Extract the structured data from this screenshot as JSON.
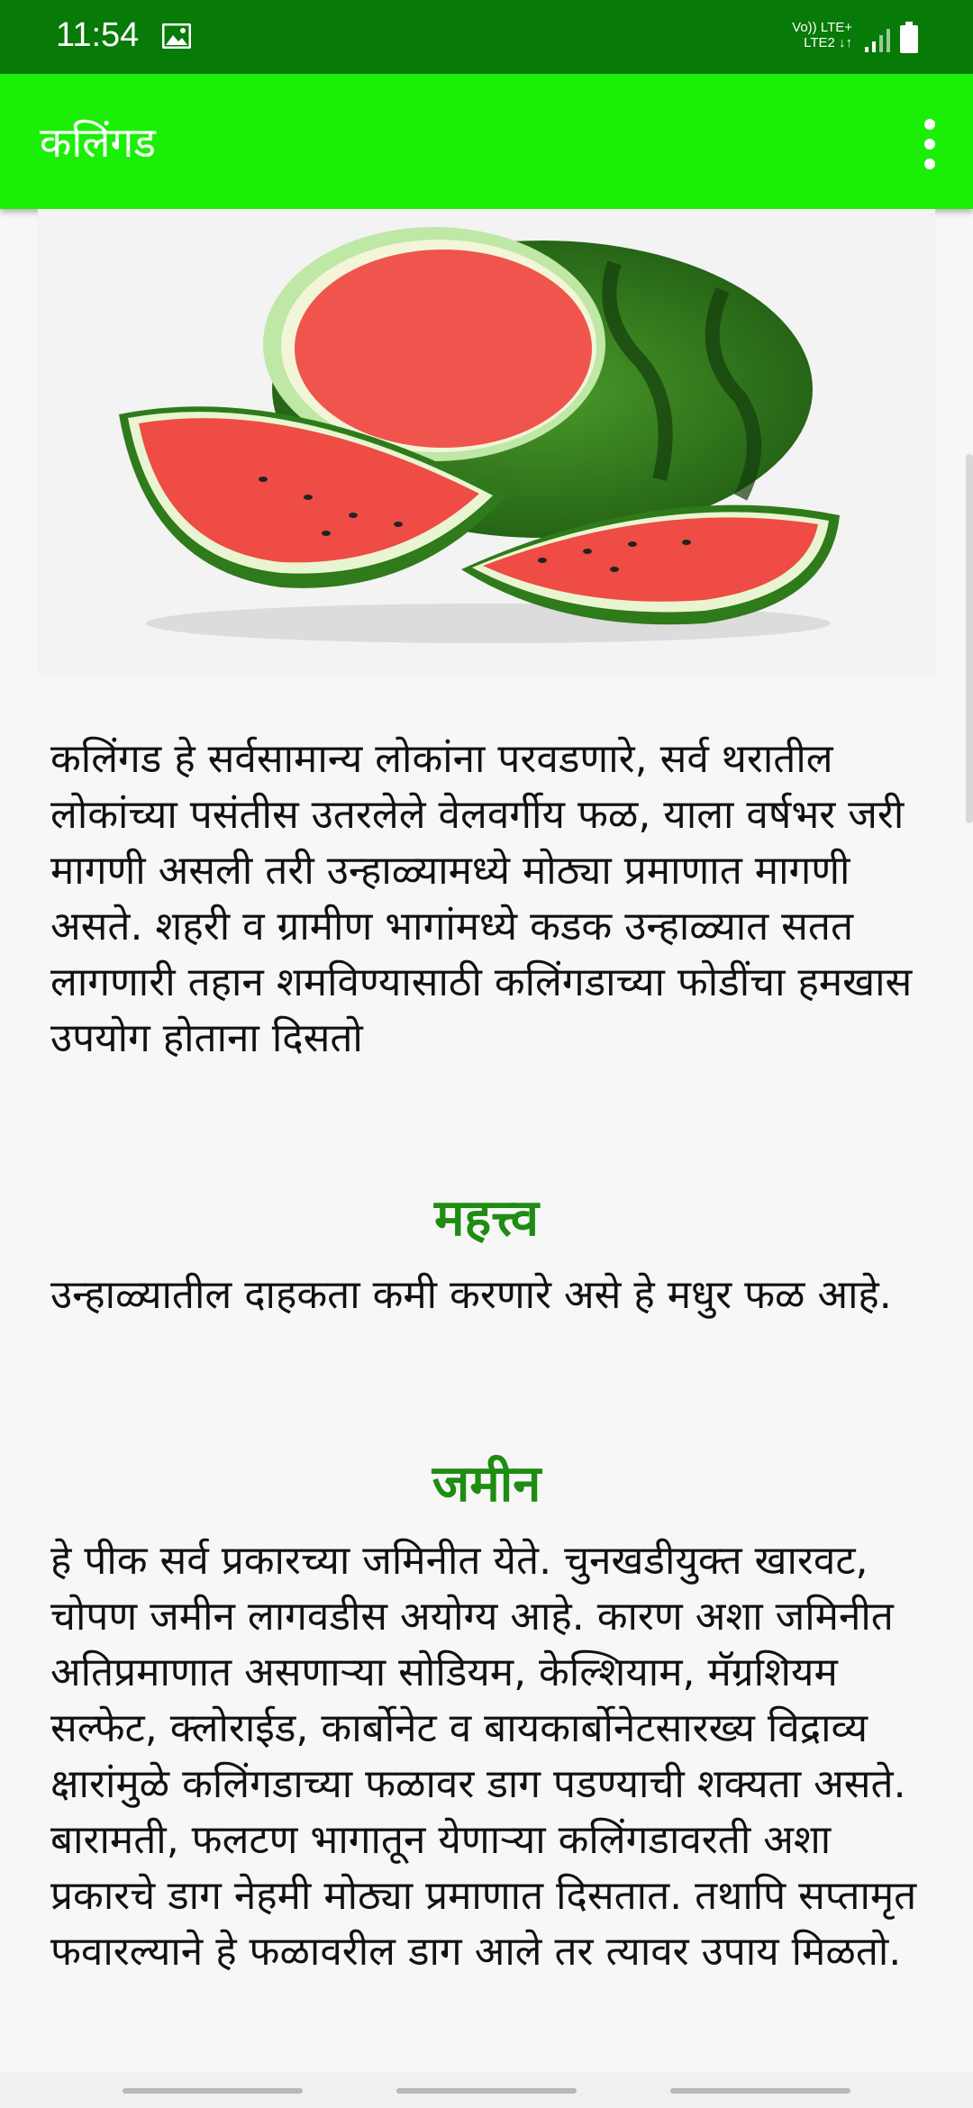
{
  "status_bar": {
    "time": "11:54",
    "network_line1": "Vo)) LTE+",
    "network_line2": "LTE2 ↓↑"
  },
  "app_bar": {
    "title": "कलिंगड",
    "menu_icon": "more-vert-icon"
  },
  "colors": {
    "status_bar": "#077a07",
    "app_bar": "#1bef08",
    "heading": "#1f8c12",
    "background": "#f7f7f7"
  },
  "article": {
    "image_alt": "watermelon-illustration",
    "intro": "कलिंगड हे सर्वसामान्य लोकांना परवडणारे, सर्व थरातील लोकांच्या पसंतीस उतरलेले वेलवर्गीय फळ, याला वर्षभर जरी मागणी असली तरी उन्हाळ्यामध्ये मोठ्या प्रमाणात मागणी असते. शहरी व ग्रामीण भागांमध्ये कडक उन्हाळ्यात सतत लागणारी तहान शमविण्यासाठी कलिंगडाच्या फोडींचा हमखास उपयोग होताना दिसतो",
    "sections": [
      {
        "heading": "महत्त्व",
        "body": "उन्हाळ्यातील दाहकता कमी करणारे असे हे मधुर फळ आहे."
      },
      {
        "heading": "जमीन",
        "body": "हे पीक सर्व प्रकारच्या जमिनीत येते. चुनखडीयुक्त खारवट, चोपण जमीन लागवडीस अयोग्य आहे. कारण अशा जमिनीत अतिप्रमाणात असणाऱ्या सोडियम, केल्शियाम, मॅग्रशियम सल्फेट, क्लोराईड, कार्बोनेट व बायकार्बोनेटसारख्य विद्राव्य क्षारांमुळे कलिंगडाच्या फळावर डाग पडण्याची शक्यता असते. बारामती, फलटण भागातून येणाऱ्या कलिंगडावरती अशा प्रकारचे डाग नेहमी मोठ्या प्रमाणात दिसतात. तथापि सप्तामृत फवारल्याने हे फळावरील डाग आले तर त्यावर उपाय मिळतो."
      }
    ]
  }
}
